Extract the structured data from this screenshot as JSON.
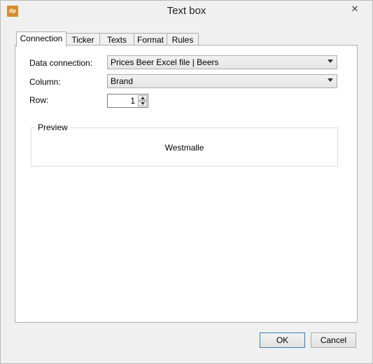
{
  "window": {
    "title": "Text box",
    "app_icon_text": "dp"
  },
  "tabs": [
    {
      "label": "Connection",
      "active": true
    },
    {
      "label": "Ticker",
      "active": false
    },
    {
      "label": "Texts",
      "active": false
    },
    {
      "label": "Format",
      "active": false
    },
    {
      "label": "Rules",
      "active": false
    }
  ],
  "form": {
    "data_connection_label": "Data connection:",
    "data_connection_value": "Prices Beer Excel file | Beers",
    "column_label": "Column:",
    "column_value": "Brand",
    "row_label": "Row:",
    "row_value": "1"
  },
  "preview": {
    "legend": "Preview",
    "text": "Westmalle"
  },
  "buttons": {
    "ok": "OK",
    "cancel": "Cancel"
  },
  "icons": {
    "close": "close-icon",
    "app": "dp-logo-icon"
  }
}
